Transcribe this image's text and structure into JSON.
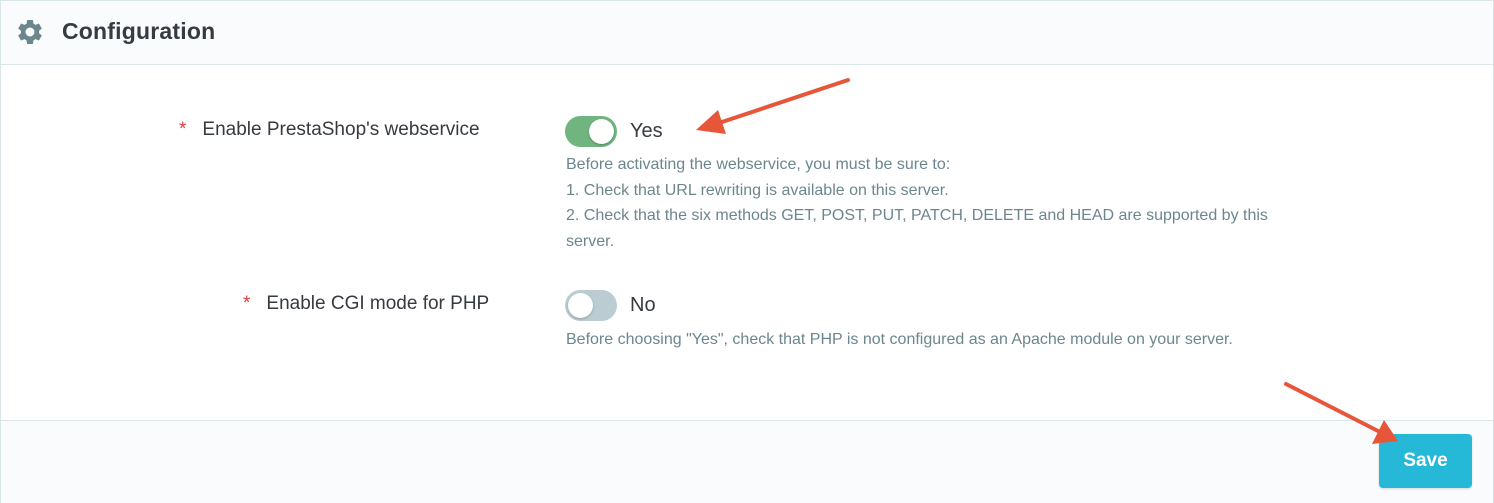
{
  "header": {
    "title": "Configuration",
    "icon": "gear-icon"
  },
  "fields": [
    {
      "required_mark": "*",
      "label": "Enable PrestaShop's webservice",
      "switch_state": "Yes",
      "switch_on": true,
      "help": [
        "Before activating the webservice, you must be sure to:",
        "1. Check that URL rewriting is available on this server.",
        "2. Check that the six methods GET, POST, PUT, PATCH, DELETE and HEAD are supported by this",
        "server."
      ]
    },
    {
      "required_mark": "*",
      "label": "Enable CGI mode for PHP",
      "switch_state": "No",
      "switch_on": false,
      "help": [
        "Before choosing \"Yes\", check that PHP is not configured as an Apache module on your server."
      ]
    }
  ],
  "footer": {
    "save_label": "Save"
  },
  "colors": {
    "accent": "#25b9d7",
    "switch_on": "#70b580",
    "switch_off": "#bbcdd2",
    "required": "#e13d3d",
    "annotation_arrow": "#e8563a"
  }
}
